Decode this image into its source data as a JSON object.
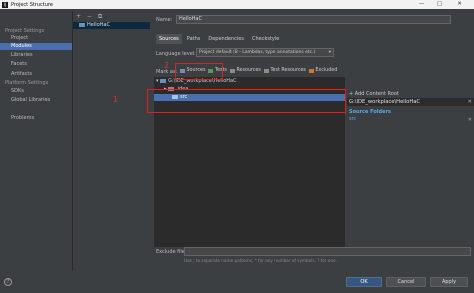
{
  "window": {
    "title": "Project Structure",
    "controls": [
      "—",
      "□",
      "✕"
    ]
  },
  "toolbar_left": {
    "back": "←",
    "forward": "→"
  },
  "settings": {
    "project_settings_header": "Project Settings",
    "project_items": [
      "Project",
      "Modules",
      "Libraries",
      "Facets",
      "Artifacts"
    ],
    "platform_settings_header": "Platform Settings",
    "platform_items": [
      "SDKs",
      "Global Libraries"
    ],
    "problems": "Problems",
    "selected": "Modules"
  },
  "modules_panel": {
    "tools": "+ − ⧉",
    "module_name": "HelloHaC"
  },
  "module": {
    "name_label": "Name:",
    "name_value": "HelloHaC",
    "tabs": [
      "Sources",
      "Paths",
      "Dependencies",
      "Checkstyle"
    ],
    "active_tab": "Sources",
    "language_level_label": "Language level:",
    "language_level_value": "Project default (8 - Lambdas, type annotations etc.)",
    "mark_as_label": "Mark as:",
    "mark_as_items": [
      {
        "label": "Sources",
        "color": "#6f8fb6"
      },
      {
        "label": "Tests",
        "color": "#5f9460"
      },
      {
        "label": "Resources",
        "color": "#8b8b8b"
      },
      {
        "label": "Test Resources",
        "color": "#8b8b8b"
      },
      {
        "label": "Excluded",
        "color": "#d2762e"
      }
    ],
    "tree": {
      "root": "G:\\IDE_workplace\\HelloHaC",
      "children": [
        ".idea",
        "src"
      ],
      "selected": "src"
    },
    "content_root": {
      "add_label": "+ Add Content Root",
      "path": "G:\\IDE_workplace\\HelloHaC",
      "close": "✕",
      "source_folders_label": "Source Folders",
      "source_entry": "src",
      "source_entry_close": "✕"
    },
    "exclude_label": "Exclude files:",
    "exclude_hint": "Use ; to separate name patterns, * for any number of symbols, ? for one."
  },
  "buttons": {
    "help": "?",
    "ok": "OK",
    "cancel": "Cancel",
    "apply": "Apply"
  },
  "annotations": {
    "one": "1",
    "two": "2",
    "color": "#e02020"
  }
}
